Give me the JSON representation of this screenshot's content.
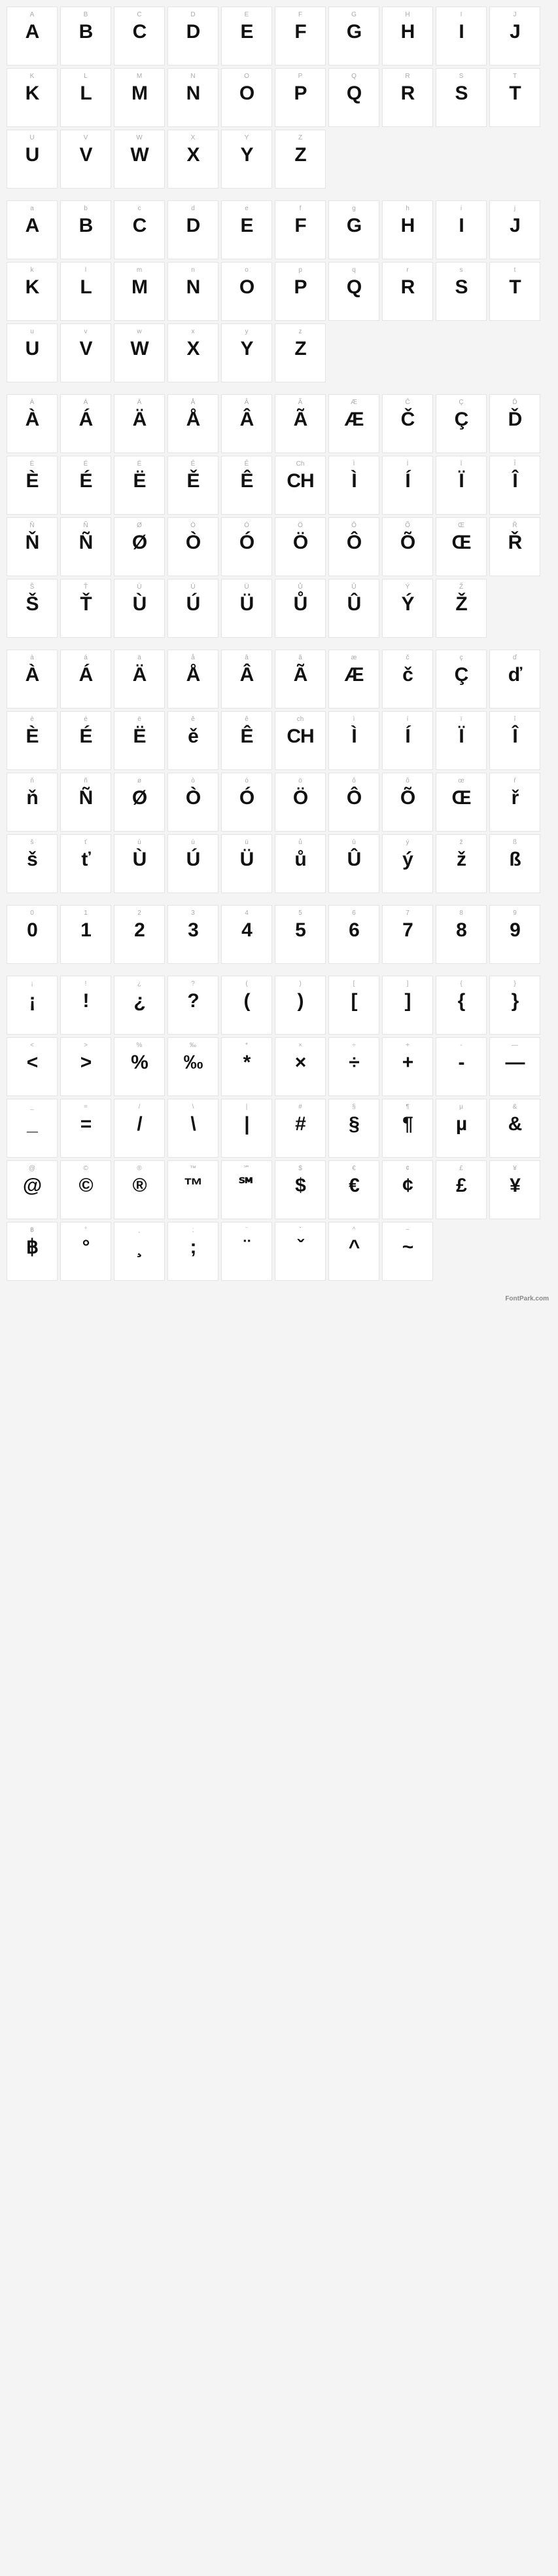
{
  "footer": "FontPark.com",
  "sections": [
    {
      "name": "uppercase",
      "cells": [
        {
          "label": "A",
          "glyph": "A"
        },
        {
          "label": "B",
          "glyph": "B"
        },
        {
          "label": "C",
          "glyph": "C"
        },
        {
          "label": "D",
          "glyph": "D"
        },
        {
          "label": "E",
          "glyph": "E"
        },
        {
          "label": "F",
          "glyph": "F"
        },
        {
          "label": "G",
          "glyph": "G"
        },
        {
          "label": "H",
          "glyph": "H"
        },
        {
          "label": "I",
          "glyph": "I"
        },
        {
          "label": "J",
          "glyph": "J"
        },
        {
          "label": "K",
          "glyph": "K"
        },
        {
          "label": "L",
          "glyph": "L"
        },
        {
          "label": "M",
          "glyph": "M"
        },
        {
          "label": "N",
          "glyph": "N"
        },
        {
          "label": "O",
          "glyph": "O"
        },
        {
          "label": "P",
          "glyph": "P"
        },
        {
          "label": "Q",
          "glyph": "Q"
        },
        {
          "label": "R",
          "glyph": "R"
        },
        {
          "label": "S",
          "glyph": "S"
        },
        {
          "label": "T",
          "glyph": "T"
        },
        {
          "label": "U",
          "glyph": "U"
        },
        {
          "label": "V",
          "glyph": "V"
        },
        {
          "label": "W",
          "glyph": "W"
        },
        {
          "label": "X",
          "glyph": "X"
        },
        {
          "label": "Y",
          "glyph": "Y"
        },
        {
          "label": "Z",
          "glyph": "Z"
        }
      ]
    },
    {
      "name": "lowercase",
      "cells": [
        {
          "label": "a",
          "glyph": "A"
        },
        {
          "label": "b",
          "glyph": "B"
        },
        {
          "label": "c",
          "glyph": "C"
        },
        {
          "label": "d",
          "glyph": "D"
        },
        {
          "label": "e",
          "glyph": "E"
        },
        {
          "label": "f",
          "glyph": "F"
        },
        {
          "label": "g",
          "glyph": "G"
        },
        {
          "label": "h",
          "glyph": "H"
        },
        {
          "label": "i",
          "glyph": "I"
        },
        {
          "label": "j",
          "glyph": "J"
        },
        {
          "label": "k",
          "glyph": "K"
        },
        {
          "label": "l",
          "glyph": "L"
        },
        {
          "label": "m",
          "glyph": "M"
        },
        {
          "label": "n",
          "glyph": "N"
        },
        {
          "label": "o",
          "glyph": "O"
        },
        {
          "label": "p",
          "glyph": "P"
        },
        {
          "label": "q",
          "glyph": "Q"
        },
        {
          "label": "r",
          "glyph": "R"
        },
        {
          "label": "s",
          "glyph": "S"
        },
        {
          "label": "t",
          "glyph": "T"
        },
        {
          "label": "u",
          "glyph": "U"
        },
        {
          "label": "v",
          "glyph": "V"
        },
        {
          "label": "w",
          "glyph": "W"
        },
        {
          "label": "x",
          "glyph": "X"
        },
        {
          "label": "y",
          "glyph": "Y"
        },
        {
          "label": "z",
          "glyph": "Z"
        }
      ]
    },
    {
      "name": "uppercase-accented",
      "cells": [
        {
          "label": "À",
          "glyph": "À"
        },
        {
          "label": "Á",
          "glyph": "Á"
        },
        {
          "label": "Ä",
          "glyph": "Ä"
        },
        {
          "label": "Å",
          "glyph": "Å"
        },
        {
          "label": "Â",
          "glyph": "Â"
        },
        {
          "label": "Ã",
          "glyph": "Ã"
        },
        {
          "label": "Æ",
          "glyph": "Æ"
        },
        {
          "label": "Č",
          "glyph": "Č"
        },
        {
          "label": "Ç",
          "glyph": "Ç"
        },
        {
          "label": "Ď",
          "glyph": "Ď"
        },
        {
          "label": "È",
          "glyph": "È"
        },
        {
          "label": "É",
          "glyph": "É"
        },
        {
          "label": "Ë",
          "glyph": "Ë"
        },
        {
          "label": "Ě",
          "glyph": "Ě"
        },
        {
          "label": "Ê",
          "glyph": "Ê"
        },
        {
          "label": "Ch",
          "glyph": "CH"
        },
        {
          "label": "Ì",
          "glyph": "Ì"
        },
        {
          "label": "Í",
          "glyph": "Í"
        },
        {
          "label": "Ï",
          "glyph": "Ï"
        },
        {
          "label": "Î",
          "glyph": "Î"
        },
        {
          "label": "Ň",
          "glyph": "Ň"
        },
        {
          "label": "Ñ",
          "glyph": "Ñ"
        },
        {
          "label": "Ø",
          "glyph": "Ø"
        },
        {
          "label": "Ò",
          "glyph": "Ò"
        },
        {
          "label": "Ó",
          "glyph": "Ó"
        },
        {
          "label": "Ö",
          "glyph": "Ö"
        },
        {
          "label": "Ô",
          "glyph": "Ô"
        },
        {
          "label": "Õ",
          "glyph": "Õ"
        },
        {
          "label": "Œ",
          "glyph": "Œ"
        },
        {
          "label": "Ř",
          "glyph": "Ř"
        },
        {
          "label": "Š",
          "glyph": "Š"
        },
        {
          "label": "Ť",
          "glyph": "Ť"
        },
        {
          "label": "Ù",
          "glyph": "Ù"
        },
        {
          "label": "Ú",
          "glyph": "Ú"
        },
        {
          "label": "Ü",
          "glyph": "Ü"
        },
        {
          "label": "Ů",
          "glyph": "Ů"
        },
        {
          "label": "Û",
          "glyph": "Û"
        },
        {
          "label": "Ý",
          "glyph": "Ý"
        },
        {
          "label": "Ž",
          "glyph": "Ž"
        }
      ]
    },
    {
      "name": "lowercase-accented",
      "cells": [
        {
          "label": "à",
          "glyph": "À"
        },
        {
          "label": "á",
          "glyph": "Á"
        },
        {
          "label": "ä",
          "glyph": "Ä"
        },
        {
          "label": "å",
          "glyph": "Å"
        },
        {
          "label": "â",
          "glyph": "Â"
        },
        {
          "label": "ã",
          "glyph": "Ã"
        },
        {
          "label": "æ",
          "glyph": "Æ"
        },
        {
          "label": "č",
          "glyph": "č"
        },
        {
          "label": "ç",
          "glyph": "Ç"
        },
        {
          "label": "ď",
          "glyph": "ď"
        },
        {
          "label": "è",
          "glyph": "È"
        },
        {
          "label": "é",
          "glyph": "É"
        },
        {
          "label": "ë",
          "glyph": "Ë"
        },
        {
          "label": "ě",
          "glyph": "ě"
        },
        {
          "label": "ê",
          "glyph": "Ê"
        },
        {
          "label": "ch",
          "glyph": "CH"
        },
        {
          "label": "ì",
          "glyph": "Ì"
        },
        {
          "label": "í",
          "glyph": "Í"
        },
        {
          "label": "ï",
          "glyph": "Ï"
        },
        {
          "label": "î",
          "glyph": "Î"
        },
        {
          "label": "ň",
          "glyph": "ň"
        },
        {
          "label": "ñ",
          "glyph": "Ñ"
        },
        {
          "label": "ø",
          "glyph": "Ø"
        },
        {
          "label": "ò",
          "glyph": "Ò"
        },
        {
          "label": "ó",
          "glyph": "Ó"
        },
        {
          "label": "ö",
          "glyph": "Ö"
        },
        {
          "label": "ô",
          "glyph": "Ô"
        },
        {
          "label": "õ",
          "glyph": "Õ"
        },
        {
          "label": "œ",
          "glyph": "Œ"
        },
        {
          "label": "ř",
          "glyph": "ř"
        },
        {
          "label": "š",
          "glyph": "š"
        },
        {
          "label": "ť",
          "glyph": "ť"
        },
        {
          "label": "ù",
          "glyph": "Ù"
        },
        {
          "label": "ú",
          "glyph": "Ú"
        },
        {
          "label": "ü",
          "glyph": "Ü"
        },
        {
          "label": "ů",
          "glyph": "ů"
        },
        {
          "label": "û",
          "glyph": "Û"
        },
        {
          "label": "ý",
          "glyph": "ý"
        },
        {
          "label": "ž",
          "glyph": "ž"
        },
        {
          "label": "ß",
          "glyph": "ß"
        }
      ]
    },
    {
      "name": "digits",
      "cells": [
        {
          "label": "0",
          "glyph": "0"
        },
        {
          "label": "1",
          "glyph": "1"
        },
        {
          "label": "2",
          "glyph": "2"
        },
        {
          "label": "3",
          "glyph": "3"
        },
        {
          "label": "4",
          "glyph": "4"
        },
        {
          "label": "5",
          "glyph": "5"
        },
        {
          "label": "6",
          "glyph": "6"
        },
        {
          "label": "7",
          "glyph": "7"
        },
        {
          "label": "8",
          "glyph": "8"
        },
        {
          "label": "9",
          "glyph": "9"
        }
      ]
    },
    {
      "name": "symbols",
      "cells": [
        {
          "label": "¡",
          "glyph": "¡"
        },
        {
          "label": "!",
          "glyph": "!"
        },
        {
          "label": "¿",
          "glyph": "¿"
        },
        {
          "label": "?",
          "glyph": "?"
        },
        {
          "label": "(",
          "glyph": "("
        },
        {
          "label": ")",
          "glyph": ")"
        },
        {
          "label": "[",
          "glyph": "["
        },
        {
          "label": "]",
          "glyph": "]"
        },
        {
          "label": "{",
          "glyph": "{"
        },
        {
          "label": "}",
          "glyph": "}"
        },
        {
          "label": "<",
          "glyph": "<"
        },
        {
          "label": ">",
          "glyph": ">"
        },
        {
          "label": "%",
          "glyph": "%"
        },
        {
          "label": "‰",
          "glyph": "‰"
        },
        {
          "label": "*",
          "glyph": "*"
        },
        {
          "label": "×",
          "glyph": "×"
        },
        {
          "label": "÷",
          "glyph": "÷"
        },
        {
          "label": "+",
          "glyph": "+"
        },
        {
          "label": "-",
          "glyph": "-"
        },
        {
          "label": "—",
          "glyph": "—"
        },
        {
          "label": "_",
          "glyph": "_"
        },
        {
          "label": "=",
          "glyph": "="
        },
        {
          "label": "/",
          "glyph": "/"
        },
        {
          "label": "\\",
          "glyph": "\\"
        },
        {
          "label": "|",
          "glyph": "|"
        },
        {
          "label": "#",
          "glyph": "#"
        },
        {
          "label": "§",
          "glyph": "§"
        },
        {
          "label": "¶",
          "glyph": "¶"
        },
        {
          "label": "µ",
          "glyph": "µ"
        },
        {
          "label": "&",
          "glyph": "&"
        },
        {
          "label": "@",
          "glyph": "@"
        },
        {
          "label": "©",
          "glyph": "©"
        },
        {
          "label": "®",
          "glyph": "®"
        },
        {
          "label": "™",
          "glyph": "™"
        },
        {
          "label": "℠",
          "glyph": "℠"
        },
        {
          "label": "$",
          "glyph": "$"
        },
        {
          "label": "€",
          "glyph": "€"
        },
        {
          "label": "¢",
          "glyph": "¢"
        },
        {
          "label": "£",
          "glyph": "£"
        },
        {
          "label": "¥",
          "glyph": "¥"
        },
        {
          "label": "฿",
          "glyph": "฿"
        },
        {
          "label": "°",
          "glyph": "°"
        },
        {
          "label": "¸",
          "glyph": "¸"
        },
        {
          "label": ";",
          "glyph": ";"
        },
        {
          "label": "¨",
          "glyph": "¨"
        },
        {
          "label": "ˇ",
          "glyph": "ˇ"
        },
        {
          "label": "^",
          "glyph": "^"
        },
        {
          "label": "~",
          "glyph": "~"
        }
      ]
    }
  ]
}
